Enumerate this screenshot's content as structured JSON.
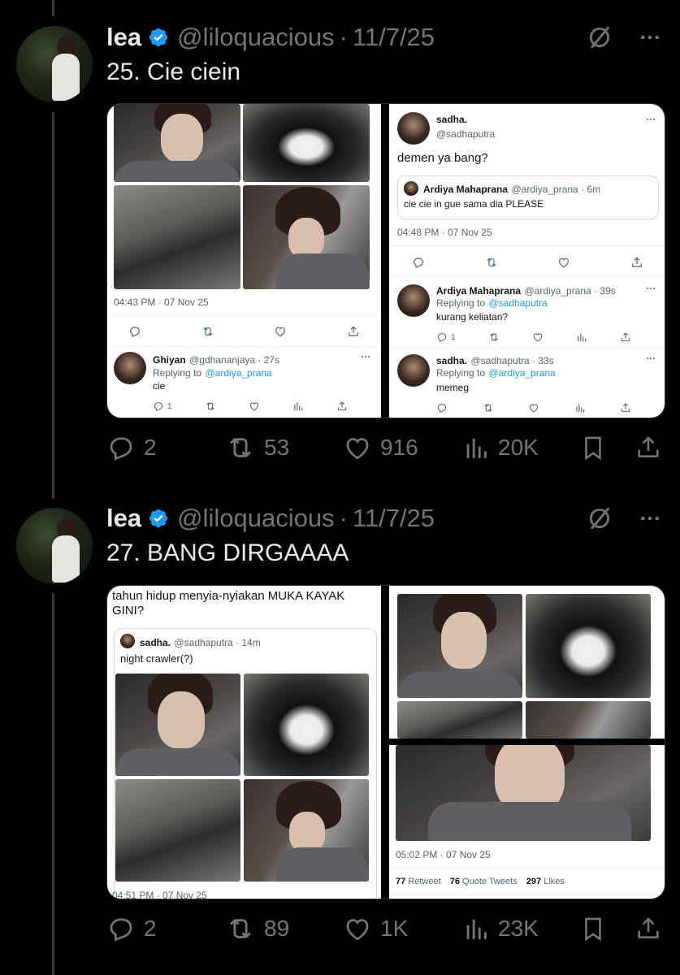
{
  "tweets": [
    {
      "name": "lea",
      "handle": "@liloquacious",
      "separator": "·",
      "date": "11/7/25",
      "text": "25. Cie ciein",
      "stats": {
        "replies": "2",
        "retweets": "53",
        "likes": "916",
        "views": "20K"
      },
      "media": {
        "left_panel": {
          "timestamp": "04:43 PM · 07 Nov 25",
          "reply": {
            "name": "Ghiyan",
            "handle": "@gdhananjaya · 27s",
            "replying_prefix": "Replying to",
            "replying_to": "@ardiya_prana",
            "text": "cie",
            "reply_count": "1"
          }
        },
        "right_panel": {
          "main": {
            "name": "sadha.",
            "handle": "@sadhaputra",
            "text": "demen ya bang?",
            "quote_name": "Ardiya Mahaprana",
            "quote_handle": "@ardiya_prana · 6m",
            "quote_text": "cie cie in gue sama dia PLEASE",
            "timestamp": "04:48 PM · 07 Nov 25"
          },
          "reply1": {
            "name": "Ardiya Mahaprana",
            "handle": "@ardiya_prana · 39s",
            "replying_prefix": "Replying to",
            "replying_to": "@sadhaputra",
            "text": "kurang keliatan?",
            "reply_count": "1"
          },
          "reply2": {
            "name": "sadha.",
            "handle": "@sadhaputra · 33s",
            "replying_prefix": "Replying to",
            "replying_to": "@ardiya_prana",
            "text": "memeg"
          }
        }
      }
    },
    {
      "name": "lea",
      "handle": "@liloquacious",
      "separator": "·",
      "date": "11/7/25",
      "text": "27. BANG DIRGAAAA",
      "stats": {
        "replies": "2",
        "retweets": "89",
        "likes": "1K",
        "views": "23K"
      },
      "media": {
        "left_panel": {
          "top_text_line1": "tahun hidup menyia-nyiakan MUKA KAYAK",
          "top_text_line2": "GINI?",
          "quote_name": "sadha.",
          "quote_handle": "@sadhaputra · 14m",
          "quote_text": "night crawler(?)",
          "timestamp": "04:51 PM · 07 Nov 25"
        },
        "right_panel": {
          "timestamp": "05:02 PM · 07 Nov 25",
          "retweets_count": "77",
          "retweets_label": "Retweet",
          "quotes_count": "76",
          "quotes_label": "Quote Tweets",
          "likes_count": "297",
          "likes_label": "Likes"
        }
      }
    }
  ],
  "icons": {
    "verified": "verified-badge-icon",
    "grok": "grok-icon",
    "more": "more-icon",
    "reply": "reply-icon",
    "retweet": "retweet-icon",
    "like": "heart-icon",
    "views": "views-icon",
    "bookmark": "bookmark-icon",
    "share": "share-icon"
  },
  "colors": {
    "background": "#000000",
    "verified": "#1d9bf0",
    "muted": "#71767b",
    "text": "#e7e9ea",
    "link": "#1d9bf0"
  }
}
